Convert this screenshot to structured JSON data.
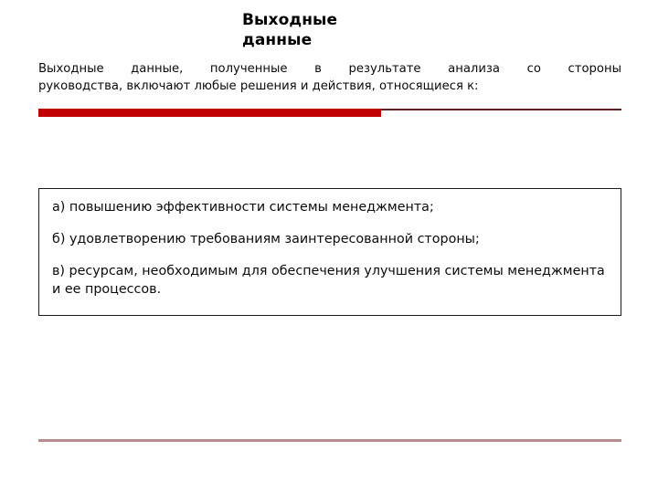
{
  "slide": {
    "title": {
      "line1": "Выходные",
      "line2": "данные"
    },
    "intro": {
      "line1": "Выходные данные, полученные в результате анализа со стороны",
      "line2": "руководства, включают любые решения и действия, относящиеся к:"
    },
    "list": {
      "items": [
        "а) повышению эффективности системы менеджмента;",
        "б) удовлетворению требованиям заинтересованной стороны;",
        "в) ресурсам, необходимым для обеспечения улучшения системы менеджмента и ее процессов."
      ]
    },
    "colors": {
      "accent_bar": "#c00000",
      "thin_rule": "#5c2020",
      "bottom_rule": "#b58b8b",
      "box_border": "#1b1b1b",
      "text": "#0b0b0b",
      "background": "#ffffff"
    }
  }
}
